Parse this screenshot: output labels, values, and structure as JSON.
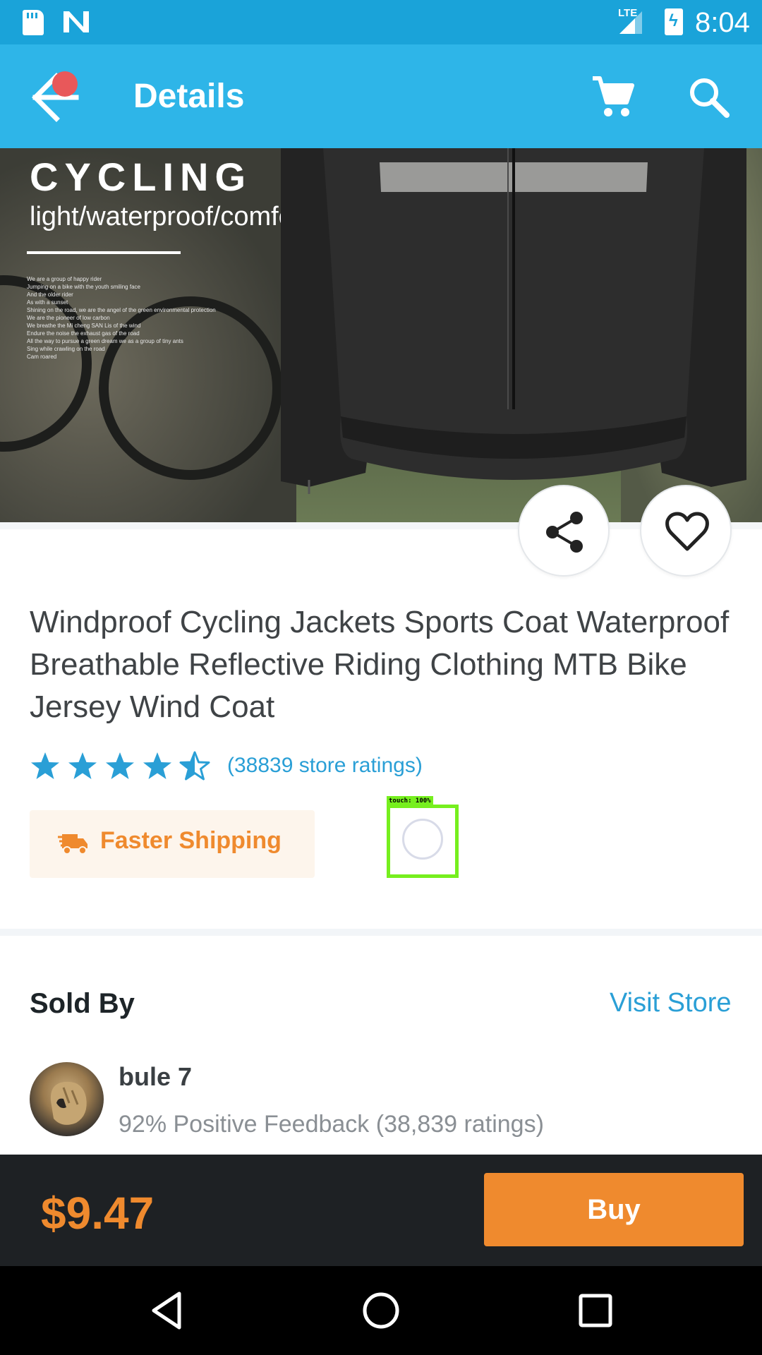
{
  "status_bar": {
    "network_label": "LTE",
    "time": "8:04",
    "icons": [
      "sd-card-icon",
      "n-notification-icon",
      "signal-icon",
      "battery-charging-icon"
    ]
  },
  "app_bar": {
    "title": "Details",
    "icons": [
      "back-arrow-icon",
      "cart-icon",
      "search-icon"
    ],
    "accent_color": "#2eb5e8"
  },
  "product_image": {
    "headline": "CYCLING",
    "subheadline": "light/waterproof/comfort",
    "body_lines": [
      "We are a group of happy rider",
      "Jumping on a bike with the youth smiling face",
      "And the older rider",
      "As with a sunset",
      "Shining on the road, we are the angel of the green environmental protection",
      "We are the pioneer of low carbon",
      "We breathe the Mi cheng SAN Lis of the wind",
      "Endure the noise the exhaust gas of the road",
      "All the way to pursue a green dream we as a group of tiny ants",
      "Sing while crawling on the road",
      "Cam roared"
    ]
  },
  "actions": {
    "share_icon": "share-icon",
    "wishlist_icon": "heart-icon"
  },
  "product": {
    "title": "Windproof Cycling Jackets Sports Coat Waterproof Breathable Reflective Riding Clothing MTB Bike Jersey Wind Coat",
    "rating_stars": 4.5,
    "rating_max": 5,
    "ratings_text": "(38839 store ratings)",
    "shipping_label": "Faster Shipping",
    "shipping_icon": "truck-icon",
    "accent_orange": "#ef8a2e",
    "link_blue": "#2a9fd6"
  },
  "touch_overlay": {
    "label": "touch: 100%"
  },
  "seller": {
    "section_title": "Sold By",
    "visit_store_label": "Visit Store",
    "name": "bule 7",
    "feedback": "92% Positive Feedback (38,839 ratings)"
  },
  "buy_bar": {
    "price": "$9.47",
    "buy_label": "Buy"
  },
  "nav_bar": {
    "icons": [
      "back-triangle-icon",
      "home-circle-icon",
      "recents-square-icon"
    ]
  }
}
